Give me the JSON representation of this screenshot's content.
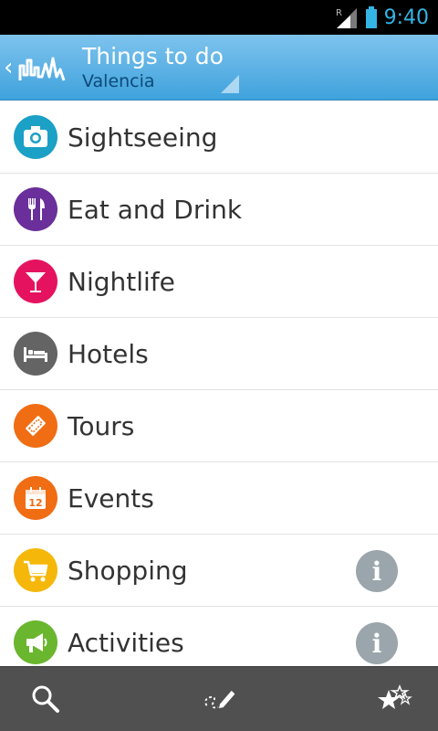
{
  "status_bar": {
    "time": "9:40",
    "signal_indicator": "R",
    "icons": [
      "signal-icon",
      "battery-icon"
    ],
    "color": "#33b5e5"
  },
  "app_bar": {
    "title": "Things to do",
    "subtitle": "Valencia",
    "back_symbol": "‹",
    "icons": [
      "back-chevron-icon",
      "city-skyline-logo-icon",
      "dropdown-corner-icon"
    ],
    "gradient": [
      "#7ec3ee",
      "#3fa2dc"
    ]
  },
  "categories": [
    {
      "label": "Sightseeing",
      "icon": "camera-icon",
      "color": "#1ba0c6",
      "info": false
    },
    {
      "label": "Eat and Drink",
      "icon": "fork-knife-icon",
      "color": "#6a2f9a",
      "info": false
    },
    {
      "label": "Nightlife",
      "icon": "cocktail-icon",
      "color": "#e5135f",
      "info": false
    },
    {
      "label": "Hotels",
      "icon": "bed-icon",
      "color": "#646464",
      "info": false
    },
    {
      "label": "Tours",
      "icon": "ticket-icon",
      "color": "#f06d14",
      "info": false
    },
    {
      "label": "Events",
      "icon": "calendar-icon",
      "color": "#f06d14",
      "info": false,
      "icon_text": "12"
    },
    {
      "label": "Shopping",
      "icon": "shopping-cart-icon",
      "color": "#f5b80a",
      "info": true
    },
    {
      "label": "Activities",
      "icon": "megaphone-icon",
      "color": "#6ab62e",
      "info": true
    }
  ],
  "info_icon": {
    "symbol": "i",
    "color": "#9aa6ab"
  },
  "bottom_bar": {
    "buttons": [
      "search-icon",
      "route-pencil-icon",
      "favorites-stars-icon"
    ]
  }
}
